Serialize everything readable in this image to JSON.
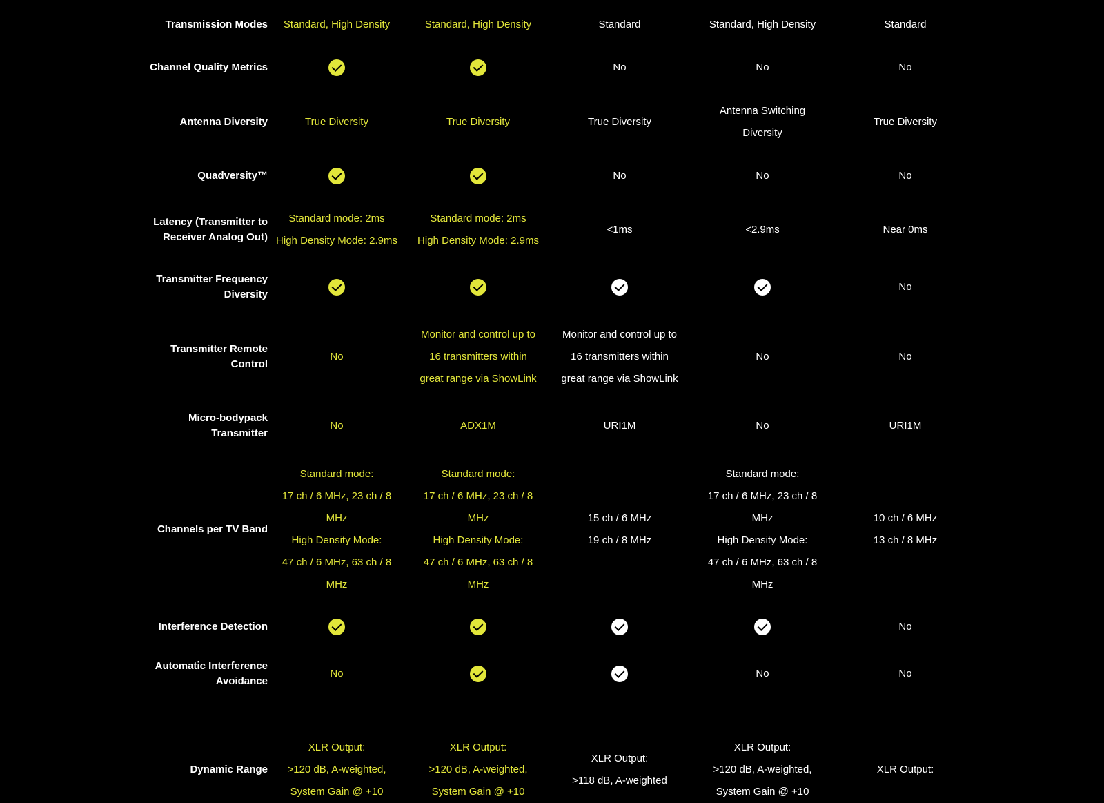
{
  "rows": [
    {
      "label": "Transmission Modes",
      "cells": [
        {
          "type": "text",
          "color": "y",
          "lines": [
            "Standard, High Density"
          ]
        },
        {
          "type": "text",
          "color": "y",
          "lines": [
            "Standard, High Density"
          ]
        },
        {
          "type": "text",
          "color": "w",
          "lines": [
            "Standard"
          ]
        },
        {
          "type": "text",
          "color": "w",
          "lines": [
            "Standard, High Density"
          ]
        },
        {
          "type": "text",
          "color": "w",
          "lines": [
            "Standard"
          ]
        }
      ]
    },
    {
      "label": "Channel Quality Metrics",
      "cells": [
        {
          "type": "check",
          "color": "y"
        },
        {
          "type": "check",
          "color": "y"
        },
        {
          "type": "text",
          "color": "w",
          "lines": [
            "No"
          ]
        },
        {
          "type": "text",
          "color": "w",
          "lines": [
            "No"
          ]
        },
        {
          "type": "text",
          "color": "w",
          "lines": [
            "No"
          ]
        }
      ]
    },
    {
      "label": "Antenna Diversity",
      "cells": [
        {
          "type": "text",
          "color": "y",
          "lines": [
            "True Diversity"
          ]
        },
        {
          "type": "text",
          "color": "y",
          "lines": [
            "True Diversity"
          ]
        },
        {
          "type": "text",
          "color": "w",
          "lines": [
            "True Diversity"
          ]
        },
        {
          "type": "text",
          "color": "w",
          "lines": [
            "Antenna Switching",
            "Diversity"
          ]
        },
        {
          "type": "text",
          "color": "w",
          "lines": [
            "True Diversity"
          ]
        }
      ]
    },
    {
      "label": "Quadversity™",
      "cells": [
        {
          "type": "check",
          "color": "y"
        },
        {
          "type": "check",
          "color": "y"
        },
        {
          "type": "text",
          "color": "w",
          "lines": [
            "No"
          ]
        },
        {
          "type": "text",
          "color": "w",
          "lines": [
            "No"
          ]
        },
        {
          "type": "text",
          "color": "w",
          "lines": [
            "No"
          ]
        }
      ]
    },
    {
      "label": "Latency (Transmitter to Receiver Analog Out)",
      "cells": [
        {
          "type": "text",
          "color": "y",
          "lines": [
            "Standard mode: 2ms",
            "High Density Mode: 2.9ms"
          ]
        },
        {
          "type": "text",
          "color": "y",
          "lines": [
            "Standard mode: 2ms",
            "High Density Mode: 2.9ms"
          ]
        },
        {
          "type": "text",
          "color": "w",
          "lines": [
            "<1ms"
          ]
        },
        {
          "type": "text",
          "color": "w",
          "lines": [
            "<2.9ms"
          ]
        },
        {
          "type": "text",
          "color": "w",
          "lines": [
            "Near 0ms"
          ]
        }
      ]
    },
    {
      "label": "Transmitter Frequency Diversity",
      "cells": [
        {
          "type": "check",
          "color": "y"
        },
        {
          "type": "check",
          "color": "y"
        },
        {
          "type": "check",
          "color": "w"
        },
        {
          "type": "check",
          "color": "w"
        },
        {
          "type": "text",
          "color": "w",
          "lines": [
            "No"
          ]
        }
      ]
    },
    {
      "label": "Transmitter Remote Control",
      "cells": [
        {
          "type": "text",
          "color": "y",
          "lines": [
            "No"
          ]
        },
        {
          "type": "text",
          "color": "y",
          "lines": [
            "Monitor and control up to",
            "16 transmitters within",
            "great range via ShowLink"
          ]
        },
        {
          "type": "text",
          "color": "w",
          "lines": [
            "Monitor and control up to",
            "16 transmitters within",
            "great range via ShowLink"
          ]
        },
        {
          "type": "text",
          "color": "w",
          "lines": [
            "No"
          ]
        },
        {
          "type": "text",
          "color": "w",
          "lines": [
            "No"
          ]
        }
      ]
    },
    {
      "label": "Micro-bodypack Transmitter",
      "cells": [
        {
          "type": "text",
          "color": "y",
          "lines": [
            "No"
          ]
        },
        {
          "type": "text",
          "color": "y",
          "lines": [
            "ADX1M"
          ]
        },
        {
          "type": "text",
          "color": "w",
          "lines": [
            "URI1M"
          ]
        },
        {
          "type": "text",
          "color": "w",
          "lines": [
            "No"
          ]
        },
        {
          "type": "text",
          "color": "w",
          "lines": [
            "URI1M"
          ]
        }
      ]
    },
    {
      "label": "Channels per TV Band",
      "cells": [
        {
          "type": "text",
          "color": "y",
          "lines": [
            "Standard mode:",
            "17 ch / 6 MHz, 23 ch / 8",
            "MHz",
            "High Density Mode:",
            "47 ch / 6 MHz, 63 ch / 8",
            "MHz"
          ]
        },
        {
          "type": "text",
          "color": "y",
          "lines": [
            "Standard mode:",
            "17 ch / 6 MHz, 23 ch / 8",
            "MHz",
            "High Density Mode:",
            "47 ch / 6 MHz, 63 ch / 8",
            "MHz"
          ]
        },
        {
          "type": "text",
          "color": "w",
          "lines": [
            "15 ch / 6 MHz",
            "19 ch / 8 MHz"
          ]
        },
        {
          "type": "text",
          "color": "w",
          "lines": [
            "Standard mode:",
            "17 ch / 6 MHz, 23 ch / 8",
            "MHz",
            "High Density Mode:",
            "47 ch / 6 MHz, 63 ch / 8",
            "MHz"
          ]
        },
        {
          "type": "text",
          "color": "w",
          "lines": [
            "10 ch / 6 MHz",
            "13 ch / 8 MHz"
          ]
        }
      ]
    },
    {
      "label": "Interference Detection",
      "cells": [
        {
          "type": "check",
          "color": "y"
        },
        {
          "type": "check",
          "color": "y"
        },
        {
          "type": "check",
          "color": "w"
        },
        {
          "type": "check",
          "color": "w"
        },
        {
          "type": "text",
          "color": "w",
          "lines": [
            "No"
          ]
        }
      ]
    },
    {
      "label": "Automatic Interference Avoidance",
      "cells": [
        {
          "type": "text",
          "color": "y",
          "lines": [
            "No"
          ]
        },
        {
          "type": "check",
          "color": "y"
        },
        {
          "type": "check",
          "color": "w"
        },
        {
          "type": "text",
          "color": "w",
          "lines": [
            "No"
          ]
        },
        {
          "type": "text",
          "color": "w",
          "lines": [
            "No"
          ]
        }
      ]
    },
    {
      "label": "Dynamic Range",
      "cells": [
        {
          "type": "text",
          "color": "y",
          "lines": [
            "XLR Output:",
            ">120 dB, A-weighted,",
            "System Gain @ +10"
          ]
        },
        {
          "type": "text",
          "color": "y",
          "lines": [
            "XLR Output:",
            ">120 dB, A-weighted,",
            "System Gain @ +10"
          ]
        },
        {
          "type": "text",
          "color": "w",
          "lines": [
            "XLR Output:",
            ">118 dB, A-weighted"
          ]
        },
        {
          "type": "text",
          "color": "w",
          "lines": [
            "XLR Output:",
            ">120 dB, A-weighted,",
            "System Gain @ +10"
          ]
        },
        {
          "type": "text",
          "color": "w",
          "lines": [
            "XLR Output:"
          ]
        }
      ]
    }
  ]
}
